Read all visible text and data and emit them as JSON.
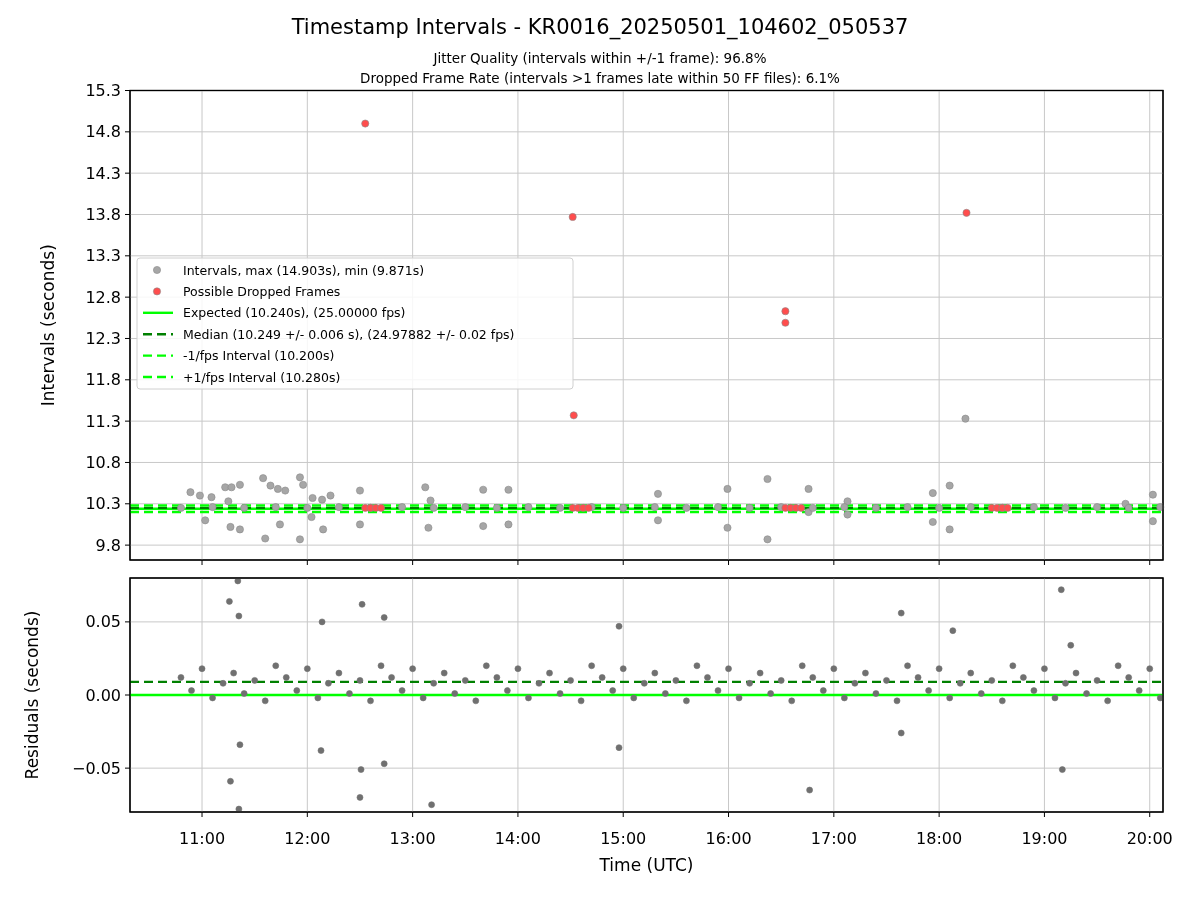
{
  "figure": {
    "title": "Timestamp Intervals - KR0016_20250501_104602_050537",
    "subtitle_lines": [
      "Jitter Quality (intervals within +/-1 frame): 96.8%",
      "Dropped Frame Rate (intervals >1 frames late within 50 FF files): 6.1%"
    ]
  },
  "top_panel": {
    "chart_data": {
      "type": "scatter",
      "ylabel": "Intervals (seconds)",
      "xlim": [
        10.316,
        20.126
      ],
      "ylim": [
        9.62,
        15.3
      ],
      "grid": true,
      "yticks": [
        {
          "value": 9.8,
          "label": "9.8"
        },
        {
          "value": 10.3,
          "label": "10.3"
        },
        {
          "value": 10.8,
          "label": "10.8"
        },
        {
          "value": 11.3,
          "label": "11.3"
        },
        {
          "value": 11.8,
          "label": "11.8"
        },
        {
          "value": 12.3,
          "label": "12.3"
        },
        {
          "value": 12.8,
          "label": "12.8"
        },
        {
          "value": 13.3,
          "label": "13.3"
        },
        {
          "value": 13.8,
          "label": "13.8"
        },
        {
          "value": 14.3,
          "label": "14.3"
        },
        {
          "value": 14.8,
          "label": "14.8"
        },
        {
          "value": 15.3,
          "label": "15.3"
        }
      ],
      "legend": true,
      "series": [
        {
          "name": "Intervals, max (14.903s), min (9.871s)",
          "color": "#a6a6a6",
          "x": [
            10.89,
            10.98,
            11.03,
            11.09,
            11.22,
            11.28,
            11.36,
            11.25,
            11.27,
            11.36,
            11.58,
            11.65,
            11.72,
            11.79,
            11.6,
            11.74,
            11.93,
            11.96,
            11.93,
            12.05,
            12.14,
            12.22,
            12.15,
            12.04,
            12.5,
            12.5,
            13.12,
            13.15,
            13.17,
            13.67,
            13.67,
            13.91,
            13.91,
            15.33,
            15.33,
            15.99,
            15.99,
            16.37,
            16.37,
            16.76,
            16.76,
            17.13,
            17.13,
            17.94,
            17.94,
            18.1,
            18.1,
            19.77,
            20.03,
            20.03,
            18.25,
            10.8,
            11.1,
            11.4,
            11.7,
            12.0,
            12.3,
            12.6,
            12.9,
            13.2,
            13.5,
            13.8,
            14.1,
            14.4,
            14.7,
            15.0,
            15.3,
            15.6,
            15.9,
            16.2,
            16.5,
            16.8,
            17.1,
            17.4,
            17.7,
            18.0,
            18.3,
            18.6,
            18.9,
            19.2,
            19.5,
            19.8,
            20.1
          ],
          "values": [
            10.44,
            10.4,
            10.1,
            10.38,
            10.5,
            10.5,
            10.53,
            10.33,
            10.02,
            9.99,
            10.61,
            10.52,
            10.48,
            10.46,
            9.88,
            10.05,
            10.62,
            10.53,
            9.87,
            10.37,
            10.35,
            10.4,
            9.99,
            10.14,
            10.46,
            10.05,
            10.5,
            10.01,
            10.34,
            10.47,
            10.03,
            10.47,
            10.05,
            10.42,
            10.1,
            10.48,
            10.01,
            10.6,
            9.87,
            10.48,
            10.2,
            10.33,
            10.17,
            10.43,
            10.08,
            10.52,
            9.99,
            10.3,
            10.41,
            10.09,
            11.33,
            10.25,
            10.26,
            10.25,
            10.26,
            10.25,
            10.26,
            10.25,
            10.26,
            10.25,
            10.26,
            10.25,
            10.26,
            10.25,
            10.26,
            10.25,
            10.26,
            10.25,
            10.26,
            10.25,
            10.26,
            10.25,
            10.26,
            10.25,
            10.26,
            10.25,
            10.26,
            10.25,
            10.26,
            10.25,
            10.26,
            10.25,
            10.26
          ]
        },
        {
          "name": "Possible Dropped Frames",
          "color": "#ff4d4d",
          "x": [
            12.55,
            14.52,
            14.53,
            16.54,
            16.54,
            18.26,
            12.55,
            12.6,
            12.65,
            12.7,
            14.52,
            14.57,
            14.62,
            14.67,
            16.54,
            16.59,
            16.64,
            16.69,
            18.5,
            18.55,
            18.6,
            18.65
          ],
          "values": [
            14.9,
            13.77,
            11.37,
            12.63,
            12.49,
            13.82,
            10.25,
            10.25,
            10.25,
            10.25,
            10.25,
            10.25,
            10.25,
            10.25,
            10.25,
            10.25,
            10.25,
            10.25,
            10.25,
            10.25,
            10.25,
            10.25
          ]
        },
        {
          "name": "Expected (10.240s), (25.00000 fps)",
          "type": "line",
          "color": "#00ff00",
          "x": [
            10.316,
            20.126
          ],
          "values": [
            10.24,
            10.24
          ]
        },
        {
          "name": "Median (10.249 +/- 0.006 s), (24.97882 +/- 0.02 fps)",
          "type": "line",
          "line_style": "dashed",
          "color": "#008000",
          "x": [
            10.316,
            20.126
          ],
          "values": [
            10.25,
            10.25
          ]
        },
        {
          "name": "-1/fps Interval (10.200s)",
          "type": "line",
          "line_style": "dashed",
          "color": "#00ff00",
          "x": [
            10.316,
            20.126
          ],
          "values": [
            10.2,
            10.2
          ]
        },
        {
          "name": "+1/fps Interval (10.280s)",
          "type": "line",
          "line_style": "dashed",
          "color": "#00ff00",
          "x": [
            10.316,
            20.126
          ],
          "values": [
            10.28,
            10.28
          ]
        }
      ]
    }
  },
  "bottom_panel": {
    "chart_data": {
      "type": "scatter",
      "xlabel": "Time (UTC)",
      "ylabel": "Residuals (seconds)",
      "xlim": [
        10.316,
        20.126
      ],
      "ylim": [
        -0.08,
        0.08
      ],
      "grid": true,
      "xticks": [
        {
          "value": 11,
          "label": "11:00"
        },
        {
          "value": 12,
          "label": "12:00"
        },
        {
          "value": 13,
          "label": "13:00"
        },
        {
          "value": 14,
          "label": "14:00"
        },
        {
          "value": 15,
          "label": "15:00"
        },
        {
          "value": 16,
          "label": "16:00"
        },
        {
          "value": 17,
          "label": "17:00"
        },
        {
          "value": 18,
          "label": "18:00"
        },
        {
          "value": 19,
          "label": "19:00"
        },
        {
          "value": 20,
          "label": "20:00"
        }
      ],
      "yticks": [
        {
          "value": -0.05,
          "label": "−0.05"
        },
        {
          "value": 0,
          "label": "0.00"
        },
        {
          "value": 0.05,
          "label": "0.05"
        }
      ],
      "legend": false,
      "series": [
        {
          "color": "#707070",
          "x": [
            10.8,
            10.9,
            11.0,
            11.1,
            11.2,
            11.3,
            11.4,
            11.5,
            11.6,
            11.7,
            11.8,
            11.9,
            12.0,
            12.1,
            12.2,
            12.3,
            12.4,
            12.5,
            12.6,
            12.7,
            12.8,
            12.9,
            13.0,
            13.1,
            13.2,
            13.3,
            13.4,
            13.5,
            13.6,
            13.7,
            13.8,
            13.9,
            14.0,
            14.1,
            14.2,
            14.3,
            14.4,
            14.5,
            14.6,
            14.7,
            14.8,
            14.9,
            15.0,
            15.1,
            15.2,
            15.3,
            15.4,
            15.5,
            15.6,
            15.7,
            15.8,
            15.9,
            16.0,
            16.1,
            16.2,
            16.3,
            16.4,
            16.5,
            16.6,
            16.7,
            16.8,
            16.9,
            17.0,
            17.1,
            17.2,
            17.3,
            17.4,
            17.5,
            17.6,
            17.7,
            17.8,
            17.9,
            18.0,
            18.1,
            18.2,
            18.3,
            18.4,
            18.5,
            18.6,
            18.7,
            18.8,
            18.9,
            19.0,
            19.1,
            19.2,
            19.3,
            19.4,
            19.5,
            19.6,
            19.7,
            19.8,
            19.9,
            20.0,
            20.1,
            11.34,
            11.26,
            11.35,
            12.14,
            12.52,
            12.73,
            14.96,
            17.64,
            18.13,
            19.16,
            19.25,
            11.36,
            11.27,
            11.35,
            12.13,
            12.51,
            12.73,
            12.5,
            13.18,
            14.96,
            16.77,
            17.64,
            19.17
          ],
          "values": [
            0.012,
            0.003,
            0.018,
            -0.002,
            0.008,
            0.015,
            0.001,
            0.01,
            -0.004,
            0.02,
            0.012,
            0.003,
            0.018,
            -0.002,
            0.008,
            0.015,
            0.001,
            0.01,
            -0.004,
            0.02,
            0.012,
            0.003,
            0.018,
            -0.002,
            0.008,
            0.015,
            0.001,
            0.01,
            -0.004,
            0.02,
            0.012,
            0.003,
            0.018,
            -0.002,
            0.008,
            0.015,
            0.001,
            0.01,
            -0.004,
            0.02,
            0.012,
            0.003,
            0.018,
            -0.002,
            0.008,
            0.015,
            0.001,
            0.01,
            -0.004,
            0.02,
            0.012,
            0.003,
            0.018,
            -0.002,
            0.008,
            0.015,
            0.001,
            0.01,
            -0.004,
            0.02,
            0.012,
            0.003,
            0.018,
            -0.002,
            0.008,
            0.015,
            0.001,
            0.01,
            -0.004,
            0.02,
            0.012,
            0.003,
            0.018,
            -0.002,
            0.008,
            0.015,
            0.001,
            0.01,
            -0.004,
            0.02,
            0.012,
            0.003,
            0.018,
            -0.002,
            0.008,
            0.015,
            0.001,
            0.01,
            -0.004,
            0.02,
            0.012,
            0.003,
            0.018,
            -0.002,
            0.078,
            0.064,
            0.054,
            0.05,
            0.062,
            0.053,
            0.047,
            0.056,
            0.044,
            0.072,
            0.034,
            -0.034,
            -0.059,
            -0.078,
            -0.038,
            -0.051,
            -0.047,
            -0.07,
            -0.075,
            -0.036,
            -0.065,
            -0.026,
            -0.051
          ]
        },
        {
          "type": "line",
          "line_style": "dashed",
          "color": "#008000",
          "x": [
            10.316,
            20.126
          ],
          "values": [
            0.009,
            0.009
          ]
        },
        {
          "type": "line",
          "color": "#00ff00",
          "x": [
            10.316,
            20.126
          ],
          "values": [
            0,
            0
          ]
        }
      ]
    }
  }
}
